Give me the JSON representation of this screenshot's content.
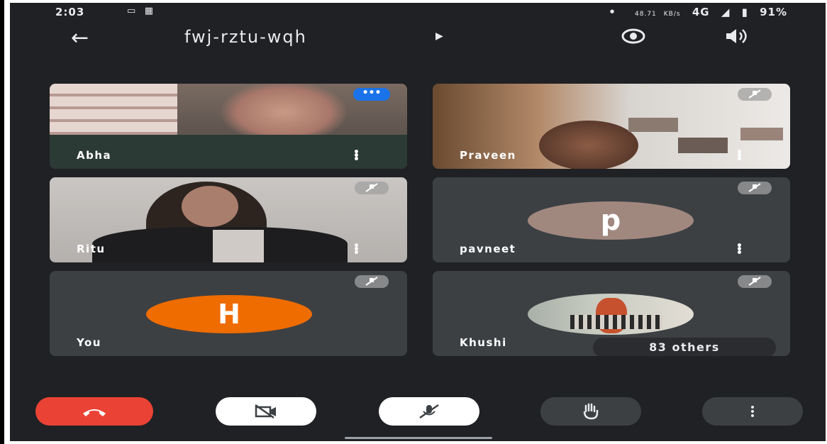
{
  "status_bar": {
    "time": "2:03",
    "speed": "48.71",
    "speed_unit": "KB/s",
    "network": "4G",
    "battery": "91%"
  },
  "header": {
    "meeting_code": "fwj-rztu-wqh"
  },
  "participants": [
    {
      "name": "Abha",
      "speaking": true,
      "muted": false
    },
    {
      "name": "Praveen",
      "muted": true
    },
    {
      "name": "Ritu",
      "muted": true
    },
    {
      "name": "pavneet",
      "avatar_letter": "p",
      "avatar_color": "#a1887f",
      "muted": true
    },
    {
      "name": "You",
      "avatar_letter": "H",
      "avatar_color": "#ef6c00",
      "muted": true
    },
    {
      "name": "Khushi",
      "muted": true
    }
  ],
  "others": {
    "label": "83 others"
  },
  "colors": {
    "background": "#202124",
    "tile": "#3c4043",
    "end_call": "#ea4335",
    "speaking_indicator": "#1a73e8"
  },
  "controls": {
    "end_call": "end-call-icon",
    "camera": "camera-off-icon",
    "mic": "mic-off-icon",
    "raise_hand": "raise-hand-icon",
    "more": "more-options-icon"
  }
}
